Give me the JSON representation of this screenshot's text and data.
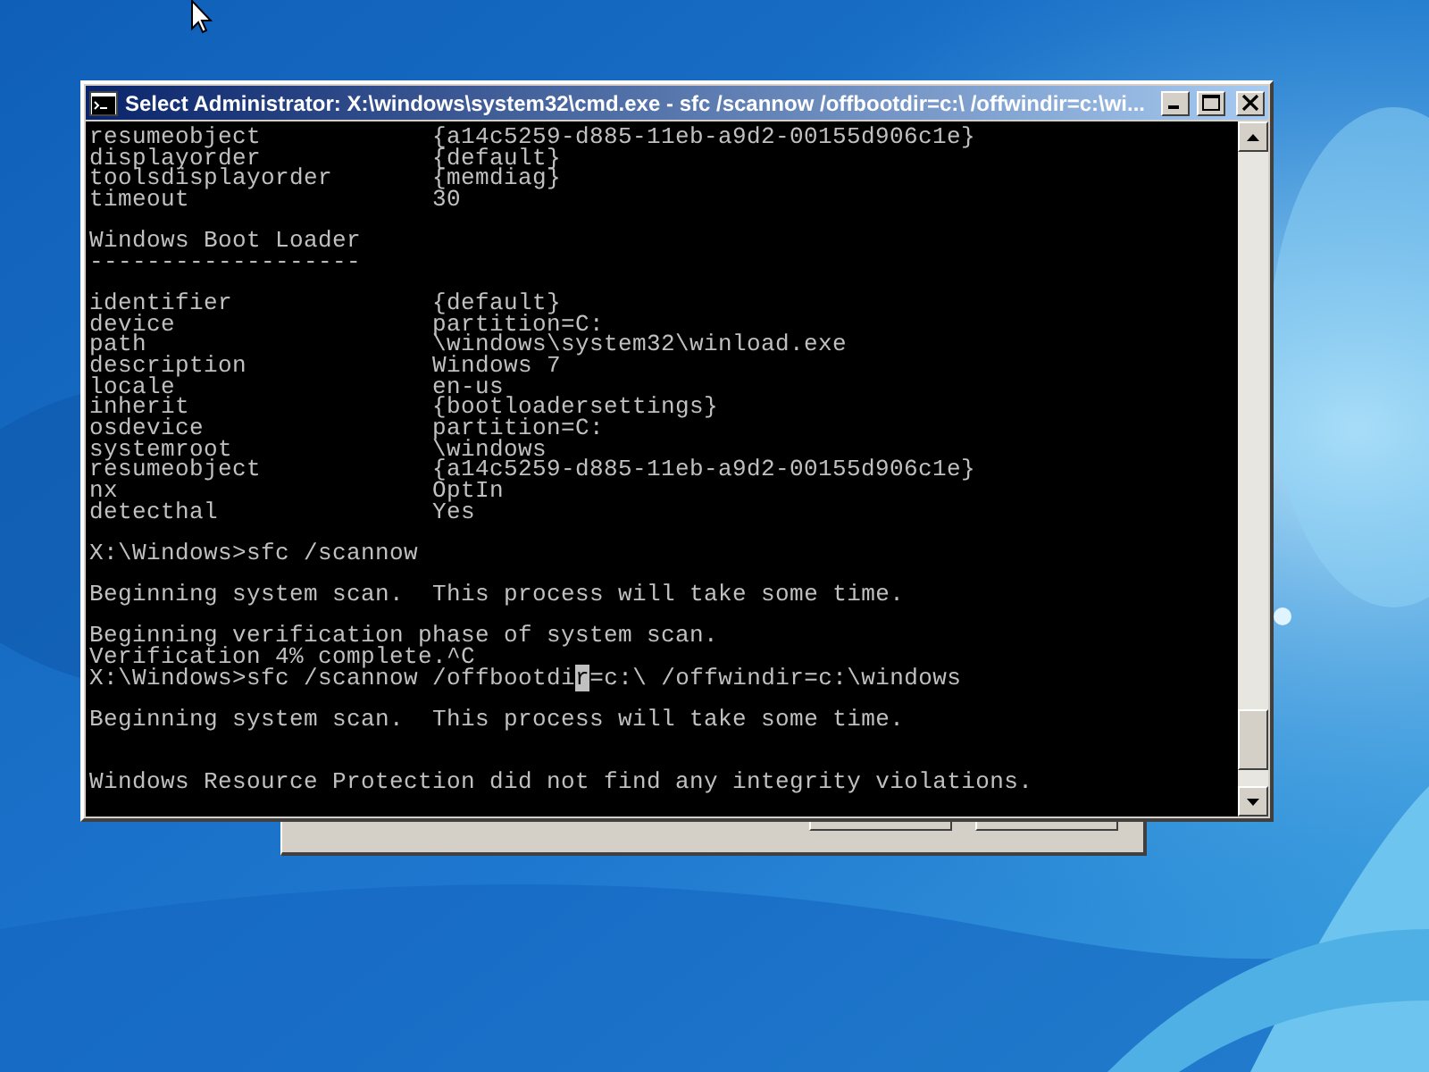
{
  "window": {
    "title": "Select Administrator: X:\\windows\\system32\\cmd.exe - sfc  /scannow /offbootdir=c:\\ /offwindir=c:\\wi..."
  },
  "console": {
    "lines": [
      {
        "kind": "pair",
        "key": "resumeobject",
        "value": "{a14c5259-d885-11eb-a9d2-00155d906c1e}"
      },
      {
        "kind": "pair",
        "key": "displayorder",
        "value": "{default}"
      },
      {
        "kind": "pair",
        "key": "toolsdisplayorder",
        "value": "{memdiag}"
      },
      {
        "kind": "pair",
        "key": "timeout",
        "value": "30"
      },
      {
        "kind": "blank"
      },
      {
        "kind": "text",
        "text": "Windows Boot Loader"
      },
      {
        "kind": "text",
        "text": "-------------------"
      },
      {
        "kind": "blank"
      },
      {
        "kind": "pair",
        "key": "identifier",
        "value": "{default}"
      },
      {
        "kind": "pair",
        "key": "device",
        "value": "partition=C:"
      },
      {
        "kind": "pair",
        "key": "path",
        "value": "\\windows\\system32\\winload.exe"
      },
      {
        "kind": "pair",
        "key": "description",
        "value": "Windows 7"
      },
      {
        "kind": "pair",
        "key": "locale",
        "value": "en-us"
      },
      {
        "kind": "pair",
        "key": "inherit",
        "value": "{bootloadersettings}"
      },
      {
        "kind": "pair",
        "key": "osdevice",
        "value": "partition=C:"
      },
      {
        "kind": "pair",
        "key": "systemroot",
        "value": "\\windows"
      },
      {
        "kind": "pair",
        "key": "resumeobject",
        "value": "{a14c5259-d885-11eb-a9d2-00155d906c1e}"
      },
      {
        "kind": "pair",
        "key": "nx",
        "value": "OptIn"
      },
      {
        "kind": "pair",
        "key": "detecthal",
        "value": "Yes"
      },
      {
        "kind": "blank"
      },
      {
        "kind": "text",
        "text": "X:\\Windows>sfc /scannow"
      },
      {
        "kind": "blank"
      },
      {
        "kind": "text",
        "text": "Beginning system scan.  This process will take some time."
      },
      {
        "kind": "blank"
      },
      {
        "kind": "text",
        "text": "Beginning verification phase of system scan."
      },
      {
        "kind": "text",
        "text": "Verification 4% complete.^C"
      },
      {
        "kind": "cursor",
        "before": "X:\\Windows>sfc /scannow /offbootdi",
        "cursor": "r",
        "after": "=c:\\ /offwindir=c:\\windows"
      },
      {
        "kind": "blank"
      },
      {
        "kind": "text",
        "text": "Beginning system scan.  This process will take some time."
      },
      {
        "kind": "blank"
      },
      {
        "kind": "blank"
      },
      {
        "kind": "text",
        "text": "Windows Resource Protection did not find any integrity violations."
      }
    ]
  }
}
